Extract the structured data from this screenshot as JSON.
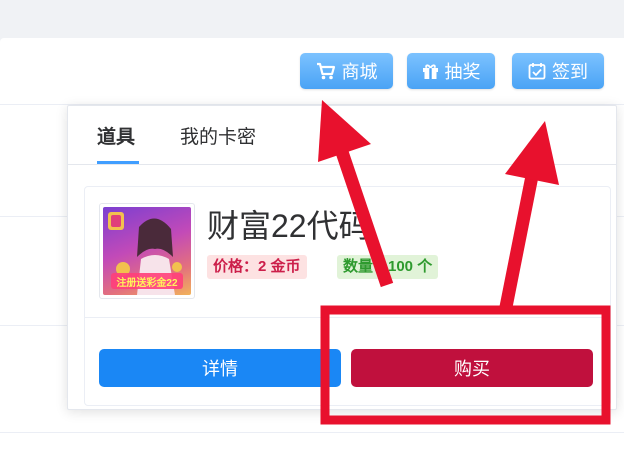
{
  "toolbar": {
    "shop_label": "商城",
    "lottery_label": "抽奖",
    "checkin_label": "签到"
  },
  "popover": {
    "tabs": [
      {
        "label": "道具",
        "active": true
      },
      {
        "label": "我的卡密",
        "active": false
      }
    ],
    "item": {
      "title": "财富22代码",
      "price_label": "价格：2 金币",
      "quantity_label": "数量：100 个",
      "thumbnail_text": "注册送彩金22"
    },
    "detail_button": "详情",
    "buy_button": "购买"
  },
  "colors": {
    "accent": "#409eff",
    "top_button": "#4aa3f5",
    "detail_button": "#1a87f5",
    "buy_button": "#c0103d",
    "annotation_red": "#e8112d"
  }
}
